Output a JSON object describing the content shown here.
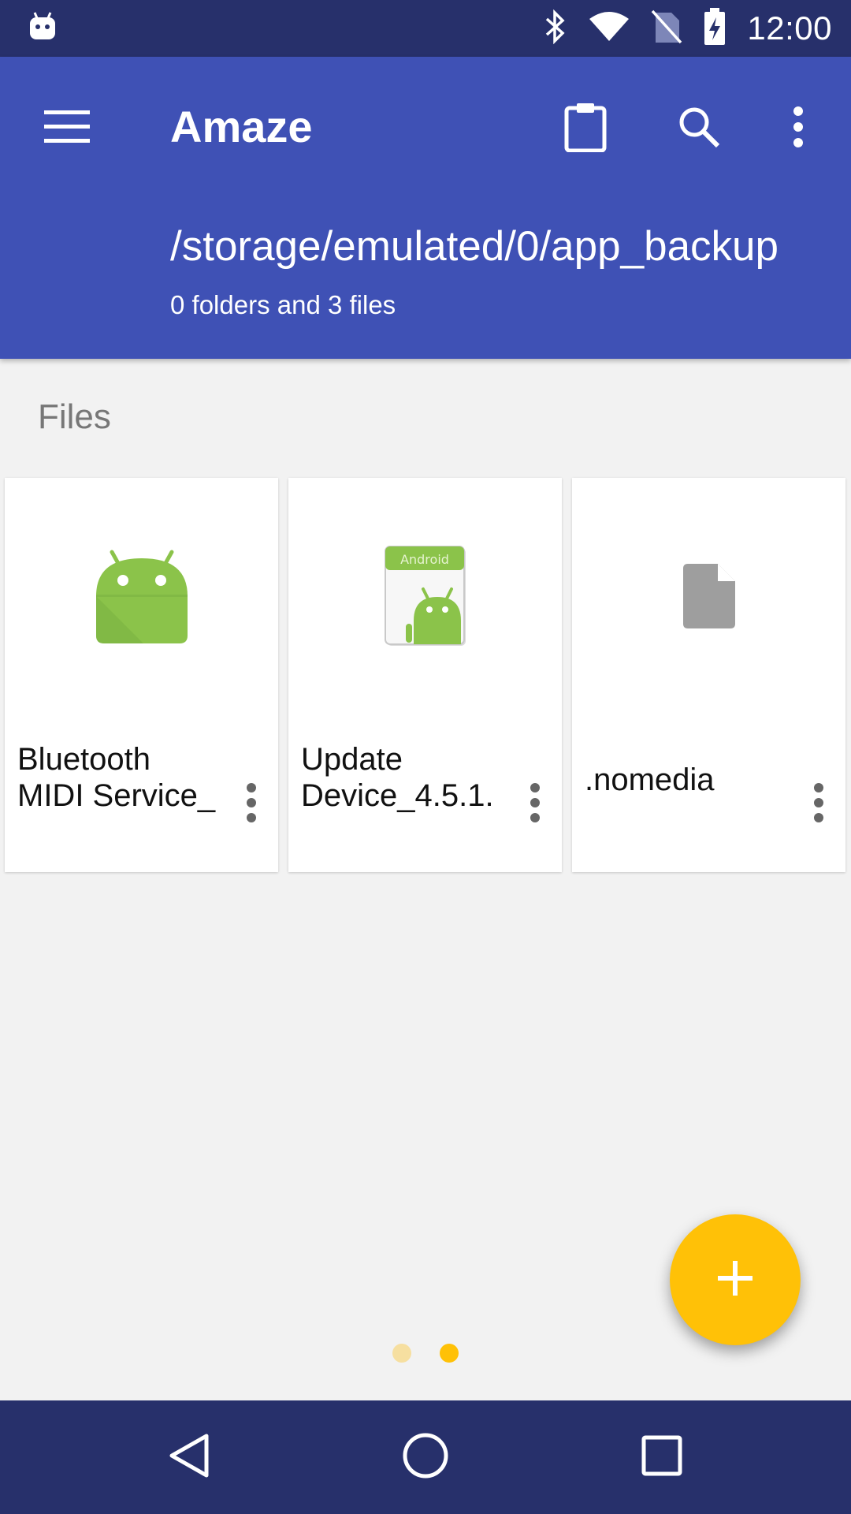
{
  "status_bar": {
    "time": "12:00",
    "icons": [
      "android-notification-icon",
      "bluetooth-icon",
      "wifi-icon",
      "no-sim-icon",
      "battery-charging-icon"
    ]
  },
  "toolbar": {
    "title": "Amaze",
    "path": "/storage/emulated/0/app_backup",
    "count": "0 folders and 3 files",
    "icons": [
      "menu-icon",
      "clipboard-icon",
      "search-icon",
      "more-vert-icon"
    ]
  },
  "section": {
    "title": "Files"
  },
  "files": [
    {
      "name": "Bluetooth\nMIDI Service_",
      "icon": "android-app-icon"
    },
    {
      "name": "Update\nDevice_4.5.1.",
      "icon": "android-apk-icon"
    },
    {
      "name": ".nomedia",
      "icon": "generic-file-icon"
    }
  ],
  "fab": {
    "icon": "plus-icon",
    "color": "#ffc107"
  },
  "pager": {
    "pages": 2,
    "active": 2
  },
  "colors": {
    "status_bar": "#27306b",
    "toolbar": "#3f51b5",
    "accent": "#ffc107",
    "background": "#f2f2f2"
  },
  "nav_bar": {
    "icons": [
      "back-icon",
      "home-icon",
      "recents-icon"
    ]
  }
}
